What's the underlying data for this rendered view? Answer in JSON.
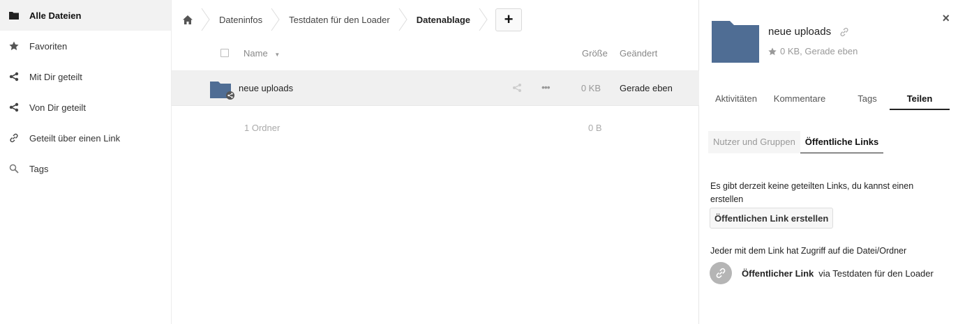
{
  "sidebar": {
    "items": [
      {
        "label": "Alle Dateien",
        "icon": "folder-icon",
        "active": true
      },
      {
        "label": "Favoriten",
        "icon": "star-icon"
      },
      {
        "label": "Mit Dir geteilt",
        "icon": "share-icon"
      },
      {
        "label": "Von Dir geteilt",
        "icon": "share-icon"
      },
      {
        "label": "Geteilt über einen Link",
        "icon": "link-icon"
      },
      {
        "label": "Tags",
        "icon": "search-icon"
      }
    ]
  },
  "breadcrumb": {
    "home_icon": "home-icon",
    "items": [
      "Dateninfos",
      "Testdaten für den Loader",
      "Datenablage"
    ],
    "add_label": "+"
  },
  "table": {
    "headers": {
      "name": "Name",
      "size": "Größe",
      "modified": "Geändert"
    },
    "rows": [
      {
        "name": "neue uploads",
        "size": "0 KB",
        "modified": "Gerade eben"
      }
    ],
    "summary": {
      "count": "1 Ordner",
      "size": "0 B"
    }
  },
  "details": {
    "close_label": "×",
    "title": "neue uploads",
    "meta": "0 KB, Gerade eben",
    "tabs": [
      "Aktivitäten",
      "Kommentare",
      "Tags",
      "Teilen"
    ],
    "active_tab": "Teilen",
    "subtabs": [
      "Nutzer und Gruppen",
      "Öffentliche Links"
    ],
    "active_subtab": "Öffentliche Links",
    "no_links_text": "Es gibt derzeit keine geteilten Links, du kannst einen erstellen",
    "create_button": "Öffentlichen Link erstellen",
    "access_text": "Jeder mit dem Link hat Zugriff auf die Datei/Ordner",
    "public_link_name": "Öffentlicher Link",
    "public_link_via": "via Testdaten für den Loader"
  },
  "colors": {
    "folder": "#4f6d94",
    "active_nav": "#f2f2f2",
    "row_hover": "#f0f0f0"
  }
}
